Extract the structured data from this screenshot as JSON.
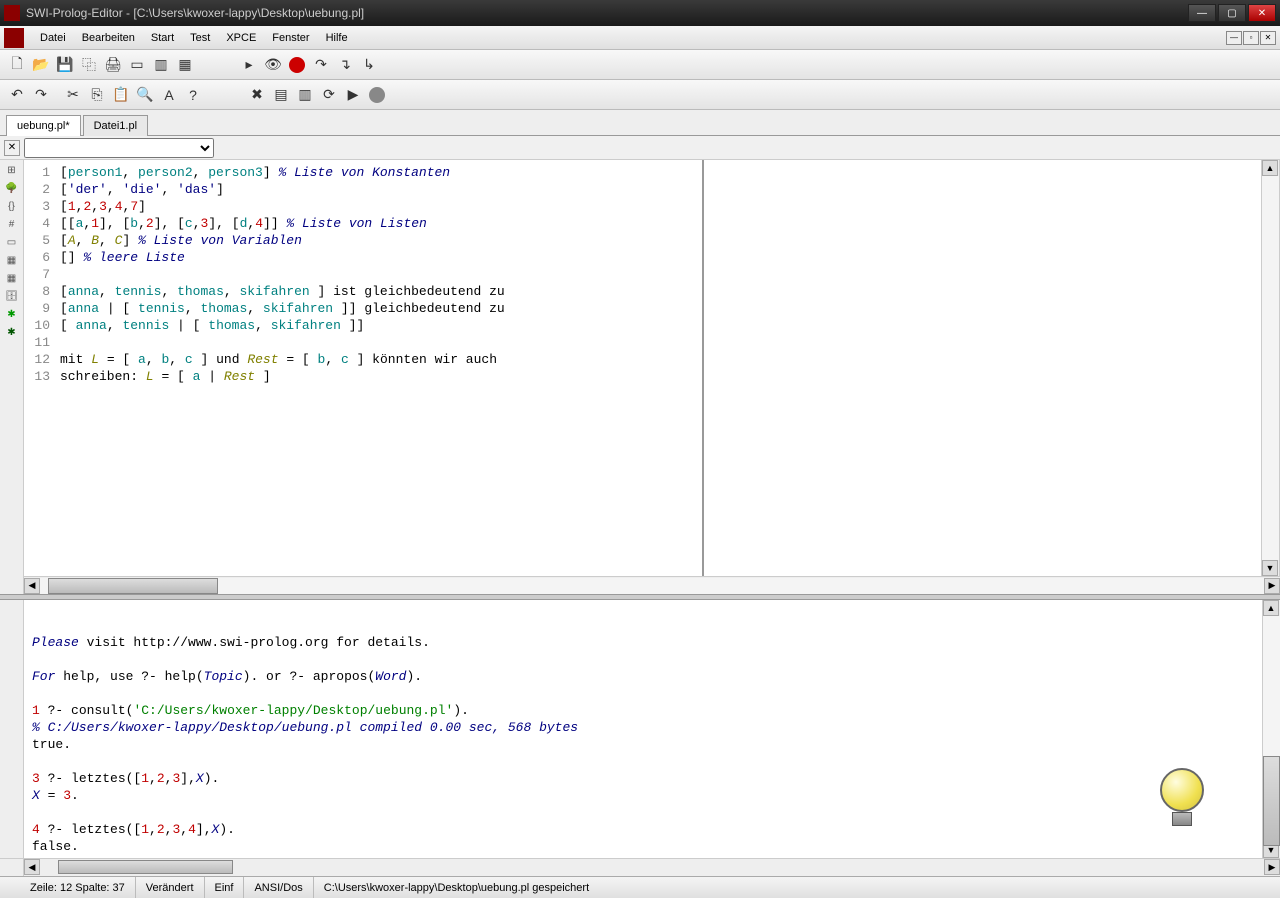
{
  "title": "SWI-Prolog-Editor - [C:\\Users\\kwoxer-lappy\\Desktop\\uebung.pl]",
  "menu": [
    "Datei",
    "Bearbeiten",
    "Start",
    "Test",
    "XPCE",
    "Fenster",
    "Hilfe"
  ],
  "tabs": [
    {
      "label": "uebung.pl*",
      "active": true
    },
    {
      "label": "Datei1.pl",
      "active": false
    }
  ],
  "editor": {
    "lines": [
      {
        "n": 1,
        "segments": [
          {
            "t": "[",
            "c": "kw-black"
          },
          {
            "t": "person1",
            "c": "kw-teal"
          },
          {
            "t": ", ",
            "c": "kw-black"
          },
          {
            "t": "person2",
            "c": "kw-teal"
          },
          {
            "t": ", ",
            "c": "kw-black"
          },
          {
            "t": "person3",
            "c": "kw-teal"
          },
          {
            "t": "] ",
            "c": "kw-black"
          },
          {
            "t": "% Liste von Konstanten",
            "c": "kw-comment"
          }
        ]
      },
      {
        "n": 2,
        "segments": [
          {
            "t": "[",
            "c": "kw-black"
          },
          {
            "t": "'der'",
            "c": "kw-str"
          },
          {
            "t": ", ",
            "c": "kw-black"
          },
          {
            "t": "'die'",
            "c": "kw-str"
          },
          {
            "t": ", ",
            "c": "kw-black"
          },
          {
            "t": "'das'",
            "c": "kw-str"
          },
          {
            "t": "]",
            "c": "kw-black"
          }
        ]
      },
      {
        "n": 3,
        "segments": [
          {
            "t": "[",
            "c": "kw-black"
          },
          {
            "t": "1",
            "c": "kw-num"
          },
          {
            "t": ",",
            "c": "kw-black"
          },
          {
            "t": "2",
            "c": "kw-num"
          },
          {
            "t": ",",
            "c": "kw-black"
          },
          {
            "t": "3",
            "c": "kw-num"
          },
          {
            "t": ",",
            "c": "kw-black"
          },
          {
            "t": "4",
            "c": "kw-num"
          },
          {
            "t": ",",
            "c": "kw-black"
          },
          {
            "t": "7",
            "c": "kw-num"
          },
          {
            "t": "]",
            "c": "kw-black"
          }
        ]
      },
      {
        "n": 4,
        "segments": [
          {
            "t": "[[",
            "c": "kw-black"
          },
          {
            "t": "a",
            "c": "kw-teal"
          },
          {
            "t": ",",
            "c": "kw-black"
          },
          {
            "t": "1",
            "c": "kw-num"
          },
          {
            "t": "], [",
            "c": "kw-black"
          },
          {
            "t": "b",
            "c": "kw-teal"
          },
          {
            "t": ",",
            "c": "kw-black"
          },
          {
            "t": "2",
            "c": "kw-num"
          },
          {
            "t": "], [",
            "c": "kw-black"
          },
          {
            "t": "c",
            "c": "kw-teal"
          },
          {
            "t": ",",
            "c": "kw-black"
          },
          {
            "t": "3",
            "c": "kw-num"
          },
          {
            "t": "], [",
            "c": "kw-black"
          },
          {
            "t": "d",
            "c": "kw-teal"
          },
          {
            "t": ",",
            "c": "kw-black"
          },
          {
            "t": "4",
            "c": "kw-num"
          },
          {
            "t": "]] ",
            "c": "kw-black"
          },
          {
            "t": "% Liste von Listen",
            "c": "kw-comment"
          }
        ]
      },
      {
        "n": 5,
        "segments": [
          {
            "t": "[",
            "c": "kw-black"
          },
          {
            "t": "A",
            "c": "kw-var"
          },
          {
            "t": ", ",
            "c": "kw-black"
          },
          {
            "t": "B",
            "c": "kw-var"
          },
          {
            "t": ", ",
            "c": "kw-black"
          },
          {
            "t": "C",
            "c": "kw-var"
          },
          {
            "t": "] ",
            "c": "kw-black"
          },
          {
            "t": "% Liste von Variablen",
            "c": "kw-comment"
          }
        ]
      },
      {
        "n": 6,
        "segments": [
          {
            "t": "[] ",
            "c": "kw-black"
          },
          {
            "t": "% leere Liste",
            "c": "kw-comment"
          }
        ]
      },
      {
        "n": 7,
        "segments": [
          {
            "t": "",
            "c": "kw-black"
          }
        ]
      },
      {
        "n": 8,
        "segments": [
          {
            "t": "[",
            "c": "kw-black"
          },
          {
            "t": "anna",
            "c": "kw-teal"
          },
          {
            "t": ", ",
            "c": "kw-black"
          },
          {
            "t": "tennis",
            "c": "kw-teal"
          },
          {
            "t": ", ",
            "c": "kw-black"
          },
          {
            "t": "thomas",
            "c": "kw-teal"
          },
          {
            "t": ", ",
            "c": "kw-black"
          },
          {
            "t": "skifahren",
            "c": "kw-teal"
          },
          {
            "t": " ] ist gleichbedeutend zu",
            "c": "kw-black"
          }
        ]
      },
      {
        "n": 9,
        "segments": [
          {
            "t": "[",
            "c": "kw-black"
          },
          {
            "t": "anna",
            "c": "kw-teal"
          },
          {
            "t": " | [ ",
            "c": "kw-black"
          },
          {
            "t": "tennis",
            "c": "kw-teal"
          },
          {
            "t": ", ",
            "c": "kw-black"
          },
          {
            "t": "thomas",
            "c": "kw-teal"
          },
          {
            "t": ", ",
            "c": "kw-black"
          },
          {
            "t": "skifahren",
            "c": "kw-teal"
          },
          {
            "t": " ]] gleichbedeutend zu",
            "c": "kw-black"
          }
        ]
      },
      {
        "n": 10,
        "segments": [
          {
            "t": "[ ",
            "c": "kw-black"
          },
          {
            "t": "anna",
            "c": "kw-teal"
          },
          {
            "t": ", ",
            "c": "kw-black"
          },
          {
            "t": "tennis",
            "c": "kw-teal"
          },
          {
            "t": " | [ ",
            "c": "kw-black"
          },
          {
            "t": "thomas",
            "c": "kw-teal"
          },
          {
            "t": ", ",
            "c": "kw-black"
          },
          {
            "t": "skifahren",
            "c": "kw-teal"
          },
          {
            "t": " ]]",
            "c": "kw-black"
          }
        ]
      },
      {
        "n": 11,
        "segments": [
          {
            "t": "",
            "c": "kw-black"
          }
        ]
      },
      {
        "n": 12,
        "segments": [
          {
            "t": "mit ",
            "c": "kw-black"
          },
          {
            "t": "L",
            "c": "kw-L"
          },
          {
            "t": " = [ ",
            "c": "kw-black"
          },
          {
            "t": "a",
            "c": "kw-teal"
          },
          {
            "t": ", ",
            "c": "kw-black"
          },
          {
            "t": "b",
            "c": "kw-teal"
          },
          {
            "t": ", ",
            "c": "kw-black"
          },
          {
            "t": "c",
            "c": "kw-teal"
          },
          {
            "t": " ] und ",
            "c": "kw-black"
          },
          {
            "t": "Rest",
            "c": "kw-L"
          },
          {
            "t": " = [ ",
            "c": "kw-black"
          },
          {
            "t": "b",
            "c": "kw-teal"
          },
          {
            "t": ", ",
            "c": "kw-black"
          },
          {
            "t": "c",
            "c": "kw-teal"
          },
          {
            "t": " ] könnten wir auch",
            "c": "kw-black"
          }
        ]
      },
      {
        "n": 13,
        "segments": [
          {
            "t": "schreiben: ",
            "c": "kw-black"
          },
          {
            "t": "L",
            "c": "kw-L"
          },
          {
            "t": " = [ ",
            "c": "kw-black"
          },
          {
            "t": "a",
            "c": "kw-teal"
          },
          {
            "t": " | ",
            "c": "kw-black"
          },
          {
            "t": "Rest",
            "c": "kw-L"
          },
          {
            "t": " ]",
            "c": "kw-black"
          }
        ]
      }
    ]
  },
  "console": {
    "lines": [
      {
        "segments": [
          {
            "t": "Please",
            "c": "kw-please"
          },
          {
            "t": " visit http://www.swi-prolog.org for details.",
            "c": "kw-black"
          }
        ]
      },
      {
        "segments": [
          {
            "t": "",
            "c": ""
          }
        ]
      },
      {
        "segments": [
          {
            "t": "For",
            "c": "kw-please"
          },
          {
            "t": " help, use ?- help(",
            "c": "kw-black"
          },
          {
            "t": "Topic",
            "c": "kw-please"
          },
          {
            "t": "). or ?- apropos(",
            "c": "kw-black"
          },
          {
            "t": "Word",
            "c": "kw-please"
          },
          {
            "t": ").",
            "c": "kw-black"
          }
        ]
      },
      {
        "segments": [
          {
            "t": "",
            "c": ""
          }
        ]
      },
      {
        "segments": [
          {
            "t": "1",
            "c": "kw-num"
          },
          {
            "t": " ?- ",
            "c": "kw-black"
          },
          {
            "t": "consult(",
            "c": "kw-black"
          },
          {
            "t": "'C:/Users/kwoxer-lappy/Desktop/uebung.pl'",
            "c": "kw-green"
          },
          {
            "t": ").",
            "c": "kw-black"
          }
        ]
      },
      {
        "segments": [
          {
            "t": "% C:/Users/kwoxer-lappy/Desktop/uebung.pl compiled 0.00 sec, 568 bytes",
            "c": "kw-comment"
          }
        ]
      },
      {
        "segments": [
          {
            "t": "true.",
            "c": "kw-black"
          }
        ]
      },
      {
        "segments": [
          {
            "t": "",
            "c": ""
          }
        ]
      },
      {
        "segments": [
          {
            "t": "3",
            "c": "kw-num"
          },
          {
            "t": " ?- letztes([",
            "c": "kw-black"
          },
          {
            "t": "1",
            "c": "kw-num"
          },
          {
            "t": ",",
            "c": "kw-black"
          },
          {
            "t": "2",
            "c": "kw-num"
          },
          {
            "t": ",",
            "c": "kw-black"
          },
          {
            "t": "3",
            "c": "kw-num"
          },
          {
            "t": "],",
            "c": "kw-black"
          },
          {
            "t": "X",
            "c": "kw-please"
          },
          {
            "t": ").",
            "c": "kw-black"
          }
        ]
      },
      {
        "segments": [
          {
            "t": "X",
            "c": "kw-please"
          },
          {
            "t": " = ",
            "c": "kw-black"
          },
          {
            "t": "3",
            "c": "kw-num"
          },
          {
            "t": ".",
            "c": "kw-black"
          }
        ]
      },
      {
        "segments": [
          {
            "t": "",
            "c": ""
          }
        ]
      },
      {
        "segments": [
          {
            "t": "4",
            "c": "kw-num"
          },
          {
            "t": " ?- letztes([",
            "c": "kw-black"
          },
          {
            "t": "1",
            "c": "kw-num"
          },
          {
            "t": ",",
            "c": "kw-black"
          },
          {
            "t": "2",
            "c": "kw-num"
          },
          {
            "t": ",",
            "c": "kw-black"
          },
          {
            "t": "3",
            "c": "kw-num"
          },
          {
            "t": ",",
            "c": "kw-black"
          },
          {
            "t": "4",
            "c": "kw-num"
          },
          {
            "t": "],",
            "c": "kw-black"
          },
          {
            "t": "X",
            "c": "kw-please"
          },
          {
            "t": ").",
            "c": "kw-black"
          }
        ]
      },
      {
        "segments": [
          {
            "t": "false.",
            "c": "kw-black"
          }
        ]
      }
    ]
  },
  "status": {
    "pos": "Zeile: 12  Spalte: 37",
    "modified": "Verändert",
    "mode": "Einf",
    "encoding": "ANSI/Dos",
    "path": "C:\\Users\\kwoxer-lappy\\Desktop\\uebung.pl gespeichert"
  }
}
